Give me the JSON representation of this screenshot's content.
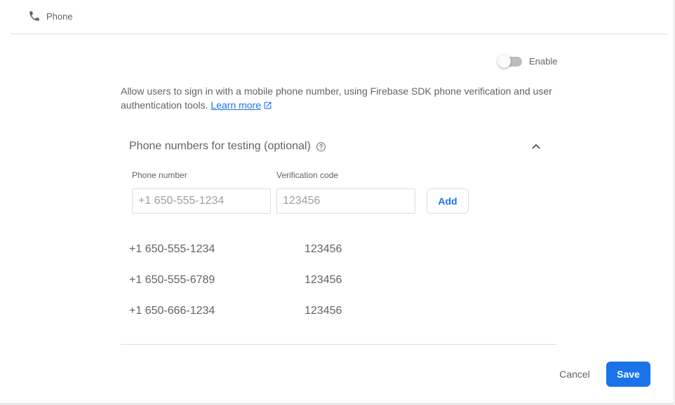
{
  "header": {
    "icon": "phone-icon",
    "title": "Phone"
  },
  "toggle": {
    "label": "Enable",
    "enabled": false
  },
  "description": {
    "text": "Allow users to sign in with a mobile phone number, using Firebase SDK phone verification and user authentication tools.",
    "link_text": "Learn more",
    "link_icon": "external-link-icon"
  },
  "testing_section": {
    "title": "Phone numbers for testing (optional)",
    "help_icon": "help-circle-icon",
    "collapse_icon": "chevron-up-icon",
    "phone_label": "Phone number",
    "phone_placeholder": "+1 650-555-1234",
    "code_label": "Verification code",
    "code_placeholder": "123456",
    "add_label": "Add",
    "numbers": [
      {
        "phone": "+1 650-555-1234",
        "code": "123456"
      },
      {
        "phone": "+1 650-555-6789",
        "code": "123456"
      },
      {
        "phone": "+1 650-666-1234",
        "code": "123456"
      }
    ]
  },
  "footer": {
    "cancel_label": "Cancel",
    "save_label": "Save"
  },
  "colors": {
    "accent": "#1a73e8",
    "text_secondary": "#5f6368",
    "divider": "#dadce0"
  }
}
